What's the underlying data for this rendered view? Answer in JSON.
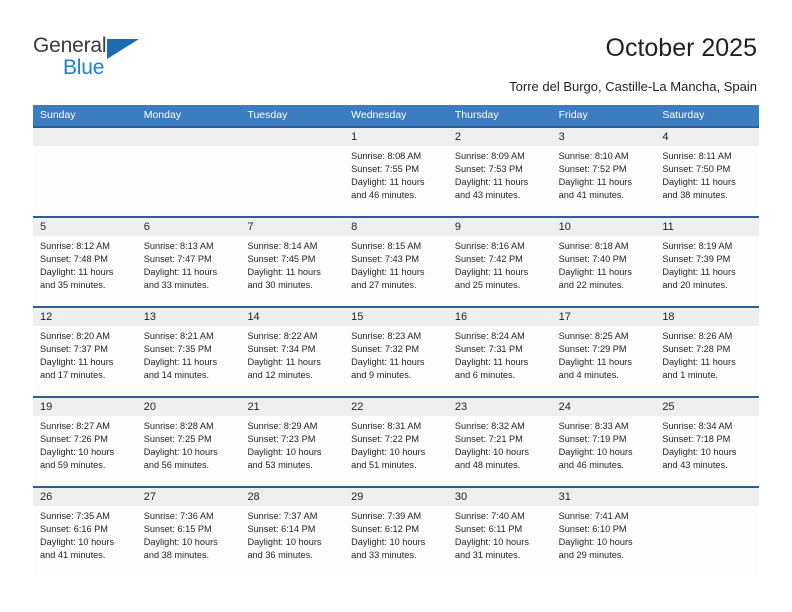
{
  "brand": {
    "name_part1": "General",
    "name_part2": "Blue"
  },
  "header": {
    "title": "October 2025",
    "subtitle": "Torre del Burgo, Castille-La Mancha, Spain"
  },
  "weekdays": [
    "Sunday",
    "Monday",
    "Tuesday",
    "Wednesday",
    "Thursday",
    "Friday",
    "Saturday"
  ],
  "colors": {
    "weekday_header_bg": "#3c7cc1",
    "week_border": "#2c5f96",
    "day_band_bg": "#efefef",
    "brand_blue": "#1f7fd4",
    "text": "#231f20"
  },
  "weeks": [
    [
      {
        "day": "",
        "lines": []
      },
      {
        "day": "",
        "lines": []
      },
      {
        "day": "",
        "lines": []
      },
      {
        "day": "1",
        "lines": [
          "Sunrise: 8:08 AM",
          "Sunset: 7:55 PM",
          "Daylight: 11 hours",
          "and 46 minutes."
        ]
      },
      {
        "day": "2",
        "lines": [
          "Sunrise: 8:09 AM",
          "Sunset: 7:53 PM",
          "Daylight: 11 hours",
          "and 43 minutes."
        ]
      },
      {
        "day": "3",
        "lines": [
          "Sunrise: 8:10 AM",
          "Sunset: 7:52 PM",
          "Daylight: 11 hours",
          "and 41 minutes."
        ]
      },
      {
        "day": "4",
        "lines": [
          "Sunrise: 8:11 AM",
          "Sunset: 7:50 PM",
          "Daylight: 11 hours",
          "and 38 minutes."
        ]
      }
    ],
    [
      {
        "day": "5",
        "lines": [
          "Sunrise: 8:12 AM",
          "Sunset: 7:48 PM",
          "Daylight: 11 hours",
          "and 35 minutes."
        ]
      },
      {
        "day": "6",
        "lines": [
          "Sunrise: 8:13 AM",
          "Sunset: 7:47 PM",
          "Daylight: 11 hours",
          "and 33 minutes."
        ]
      },
      {
        "day": "7",
        "lines": [
          "Sunrise: 8:14 AM",
          "Sunset: 7:45 PM",
          "Daylight: 11 hours",
          "and 30 minutes."
        ]
      },
      {
        "day": "8",
        "lines": [
          "Sunrise: 8:15 AM",
          "Sunset: 7:43 PM",
          "Daylight: 11 hours",
          "and 27 minutes."
        ]
      },
      {
        "day": "9",
        "lines": [
          "Sunrise: 8:16 AM",
          "Sunset: 7:42 PM",
          "Daylight: 11 hours",
          "and 25 minutes."
        ]
      },
      {
        "day": "10",
        "lines": [
          "Sunrise: 8:18 AM",
          "Sunset: 7:40 PM",
          "Daylight: 11 hours",
          "and 22 minutes."
        ]
      },
      {
        "day": "11",
        "lines": [
          "Sunrise: 8:19 AM",
          "Sunset: 7:39 PM",
          "Daylight: 11 hours",
          "and 20 minutes."
        ]
      }
    ],
    [
      {
        "day": "12",
        "lines": [
          "Sunrise: 8:20 AM",
          "Sunset: 7:37 PM",
          "Daylight: 11 hours",
          "and 17 minutes."
        ]
      },
      {
        "day": "13",
        "lines": [
          "Sunrise: 8:21 AM",
          "Sunset: 7:35 PM",
          "Daylight: 11 hours",
          "and 14 minutes."
        ]
      },
      {
        "day": "14",
        "lines": [
          "Sunrise: 8:22 AM",
          "Sunset: 7:34 PM",
          "Daylight: 11 hours",
          "and 12 minutes."
        ]
      },
      {
        "day": "15",
        "lines": [
          "Sunrise: 8:23 AM",
          "Sunset: 7:32 PM",
          "Daylight: 11 hours",
          "and 9 minutes."
        ]
      },
      {
        "day": "16",
        "lines": [
          "Sunrise: 8:24 AM",
          "Sunset: 7:31 PM",
          "Daylight: 11 hours",
          "and 6 minutes."
        ]
      },
      {
        "day": "17",
        "lines": [
          "Sunrise: 8:25 AM",
          "Sunset: 7:29 PM",
          "Daylight: 11 hours",
          "and 4 minutes."
        ]
      },
      {
        "day": "18",
        "lines": [
          "Sunrise: 8:26 AM",
          "Sunset: 7:28 PM",
          "Daylight: 11 hours",
          "and 1 minute."
        ]
      }
    ],
    [
      {
        "day": "19",
        "lines": [
          "Sunrise: 8:27 AM",
          "Sunset: 7:26 PM",
          "Daylight: 10 hours",
          "and 59 minutes."
        ]
      },
      {
        "day": "20",
        "lines": [
          "Sunrise: 8:28 AM",
          "Sunset: 7:25 PM",
          "Daylight: 10 hours",
          "and 56 minutes."
        ]
      },
      {
        "day": "21",
        "lines": [
          "Sunrise: 8:29 AM",
          "Sunset: 7:23 PM",
          "Daylight: 10 hours",
          "and 53 minutes."
        ]
      },
      {
        "day": "22",
        "lines": [
          "Sunrise: 8:31 AM",
          "Sunset: 7:22 PM",
          "Daylight: 10 hours",
          "and 51 minutes."
        ]
      },
      {
        "day": "23",
        "lines": [
          "Sunrise: 8:32 AM",
          "Sunset: 7:21 PM",
          "Daylight: 10 hours",
          "and 48 minutes."
        ]
      },
      {
        "day": "24",
        "lines": [
          "Sunrise: 8:33 AM",
          "Sunset: 7:19 PM",
          "Daylight: 10 hours",
          "and 46 minutes."
        ]
      },
      {
        "day": "25",
        "lines": [
          "Sunrise: 8:34 AM",
          "Sunset: 7:18 PM",
          "Daylight: 10 hours",
          "and 43 minutes."
        ]
      }
    ],
    [
      {
        "day": "26",
        "lines": [
          "Sunrise: 7:35 AM",
          "Sunset: 6:16 PM",
          "Daylight: 10 hours",
          "and 41 minutes."
        ]
      },
      {
        "day": "27",
        "lines": [
          "Sunrise: 7:36 AM",
          "Sunset: 6:15 PM",
          "Daylight: 10 hours",
          "and 38 minutes."
        ]
      },
      {
        "day": "28",
        "lines": [
          "Sunrise: 7:37 AM",
          "Sunset: 6:14 PM",
          "Daylight: 10 hours",
          "and 36 minutes."
        ]
      },
      {
        "day": "29",
        "lines": [
          "Sunrise: 7:39 AM",
          "Sunset: 6:12 PM",
          "Daylight: 10 hours",
          "and 33 minutes."
        ]
      },
      {
        "day": "30",
        "lines": [
          "Sunrise: 7:40 AM",
          "Sunset: 6:11 PM",
          "Daylight: 10 hours",
          "and 31 minutes."
        ]
      },
      {
        "day": "31",
        "lines": [
          "Sunrise: 7:41 AM",
          "Sunset: 6:10 PM",
          "Daylight: 10 hours",
          "and 29 minutes."
        ]
      },
      {
        "day": "",
        "lines": []
      }
    ]
  ]
}
